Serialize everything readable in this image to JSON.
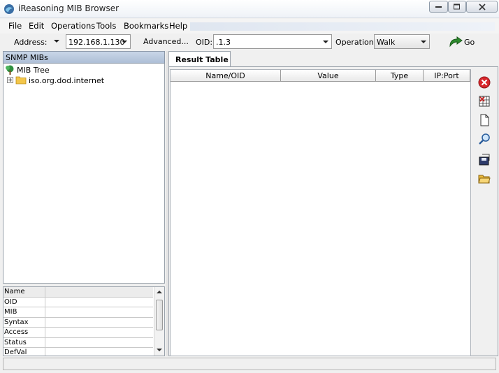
{
  "window": {
    "title": "iReasoning MIB Browser"
  },
  "menu": [
    "File",
    "Edit",
    "Operations",
    "Tools",
    "Bookmarks",
    "Help"
  ],
  "toolbar": {
    "address_label": "Address:",
    "address_value": "192.168.1.130",
    "advanced_label": "Advanced...",
    "oid_label": "OID:",
    "oid_value": ".1.3",
    "operations_label": "Operations:",
    "operations_value": "Walk",
    "go_label": "Go"
  },
  "left_pane": {
    "header": "SNMP MIBs",
    "tree": {
      "root": "MIB Tree",
      "child": "iso.org.dod.internet"
    },
    "properties": [
      "Name",
      "OID",
      "MIB",
      "Syntax",
      "Access",
      "Status",
      "DefVal"
    ]
  },
  "result": {
    "tab": "Result Table",
    "columns": [
      "Name/OID",
      "Value",
      "Type",
      "IP:Port"
    ]
  },
  "side_tools": [
    "delete-icon",
    "table-edit-icon",
    "document-icon",
    "search-icon",
    "save-icon",
    "open-folder-icon"
  ]
}
